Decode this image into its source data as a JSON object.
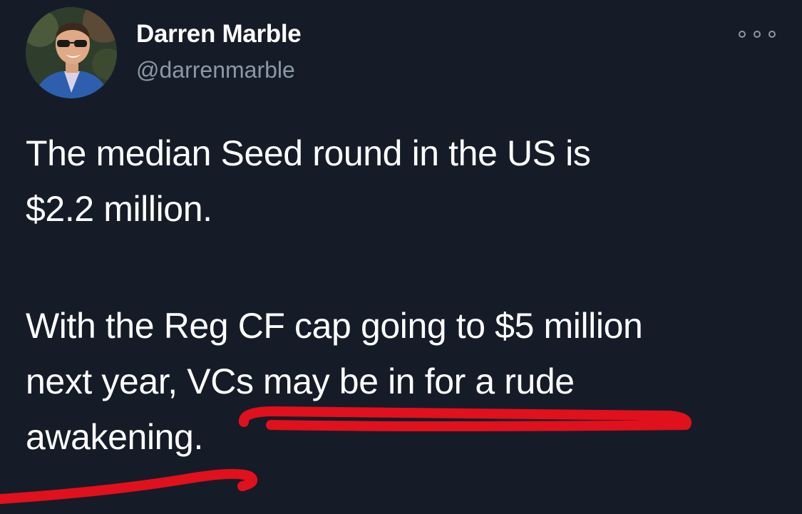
{
  "tweet": {
    "author": {
      "display_name": "Darren Marble",
      "handle": "@darrenmarble"
    },
    "menu_icon": "more-options-icon",
    "text": {
      "paragraph1": [
        "The median Seed round in the US is",
        "$2.2 million."
      ],
      "paragraph2": [
        "With the Reg CF cap going to $5 million",
        "next year, VCs may be in for a rude",
        "awakening."
      ]
    },
    "annotation": {
      "type": "red-underline-scribble",
      "color": "#e0101c"
    }
  }
}
